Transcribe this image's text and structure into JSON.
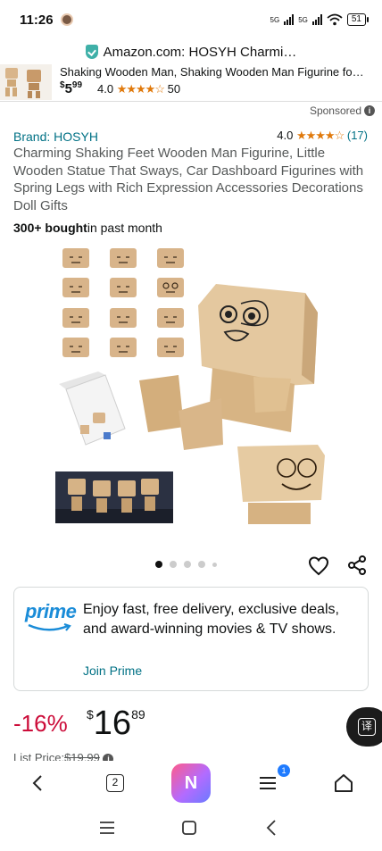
{
  "status_bar": {
    "time": "11:26",
    "network_label_1": "5G",
    "network_label_2": "5G",
    "battery": "51"
  },
  "browser": {
    "url_title": "Amazon.com: HOSYH Charmi…",
    "tab_count": "2",
    "menu_badge": "1",
    "ai_label": "N"
  },
  "sticky_ad": {
    "title": "Shaking Wooden Man, Shaking Wooden Man Figurine fo…",
    "price_symbol": "$",
    "price_whole": "5",
    "price_cents": "99",
    "rating": "4.0",
    "stars": "★★★★☆",
    "review_count": "50"
  },
  "sponsored_label": "Sponsored",
  "product": {
    "brand": "Brand: HOSYH",
    "rating": "4.0",
    "stars": "★★★★☆",
    "review_count": "(17)",
    "title": "Charming Shaking Feet Wooden Man Figurine, Little Wooden Statue That Sways, Car Dashboard Figurines with Spring Legs with Rich Expression Accessories Decorations Doll Gifts",
    "bought_bold": "300+ bought",
    "bought_rest": "in past month"
  },
  "gallery": {
    "image_count": 5,
    "active_index": 0
  },
  "prime": {
    "logo": "prime",
    "text": "Enjoy fast, free delivery, exclusive deals, and award-winning movies & TV shows.",
    "link": "Join Prime"
  },
  "pricing": {
    "discount": "-16%",
    "symbol": "$",
    "whole": "16",
    "cents": "89",
    "list_label": "List Price:",
    "list_value": "$19.99"
  },
  "translate_label": "译",
  "colors": {
    "link": "#007185",
    "star": "#e0790b",
    "discount": "#cc0c39",
    "prime_blue": "#1a8cd8"
  }
}
